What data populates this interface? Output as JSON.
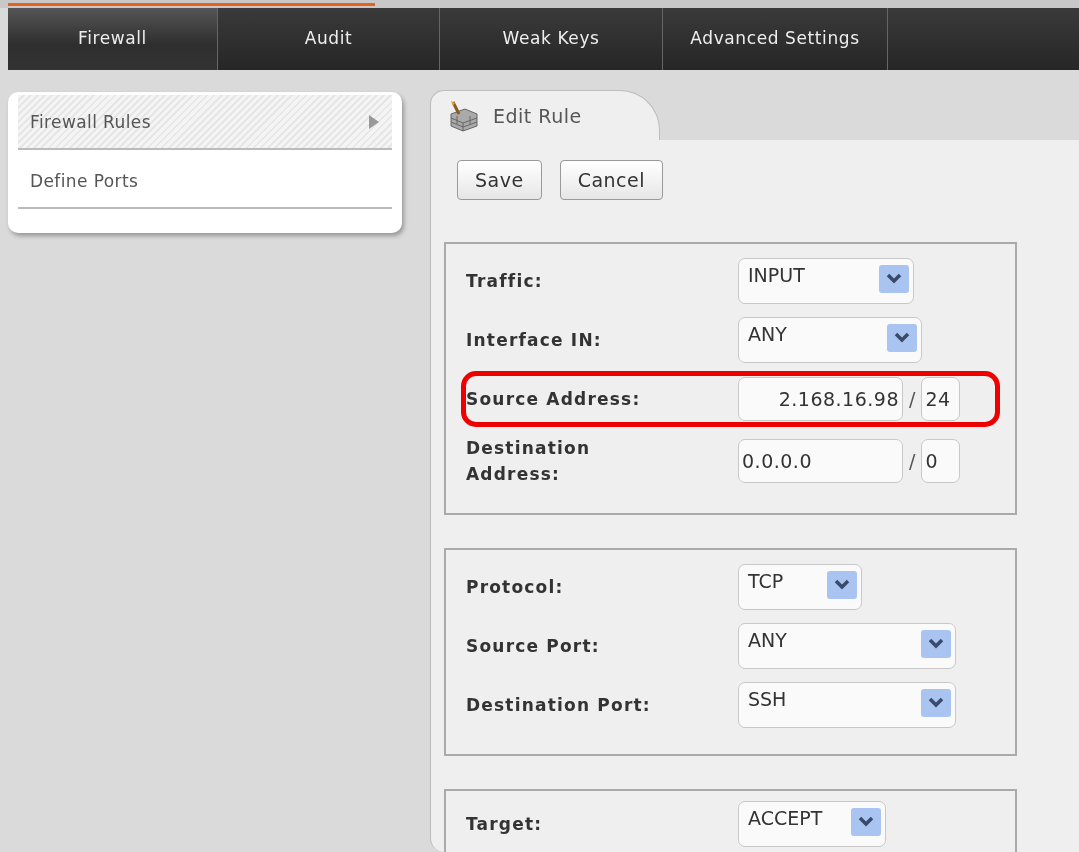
{
  "nav": [
    {
      "label": "Firewall",
      "selected": true
    },
    {
      "label": "Audit",
      "selected": false
    },
    {
      "label": "Weak Keys",
      "selected": false
    },
    {
      "label": "Advanced Settings",
      "selected": false
    }
  ],
  "sidebar": {
    "items": [
      {
        "label": "Firewall Rules",
        "selected": true
      },
      {
        "label": "Define Ports",
        "selected": false
      }
    ]
  },
  "editor": {
    "tab": "Edit Rule",
    "buttons": [
      "Save",
      "Cancel"
    ],
    "groups": [
      {
        "rows": [
          {
            "kind": "select",
            "label": "Traffic:",
            "value": "INPUT"
          },
          {
            "kind": "select",
            "label": "Interface IN:",
            "value": "ANY"
          },
          {
            "kind": "address",
            "label": "Source Address:",
            "address": "2.168.16.98",
            "separator": "/",
            "mask": "24",
            "highlighted": true
          },
          {
            "kind": "address",
            "label": "Destination Address:",
            "address": "0.0.0.0",
            "separator": "/",
            "mask": "0",
            "highlighted": false
          }
        ]
      },
      {
        "rows": [
          {
            "kind": "select",
            "label": "Protocol:",
            "value": "TCP"
          },
          {
            "kind": "select",
            "label": "Source Port:",
            "value": "ANY"
          },
          {
            "kind": "select",
            "label": "Destination Port:",
            "value": "SSH"
          }
        ]
      },
      {
        "rows": [
          {
            "kind": "select",
            "label": "Target:",
            "value": "ACCEPT"
          }
        ]
      }
    ]
  }
}
